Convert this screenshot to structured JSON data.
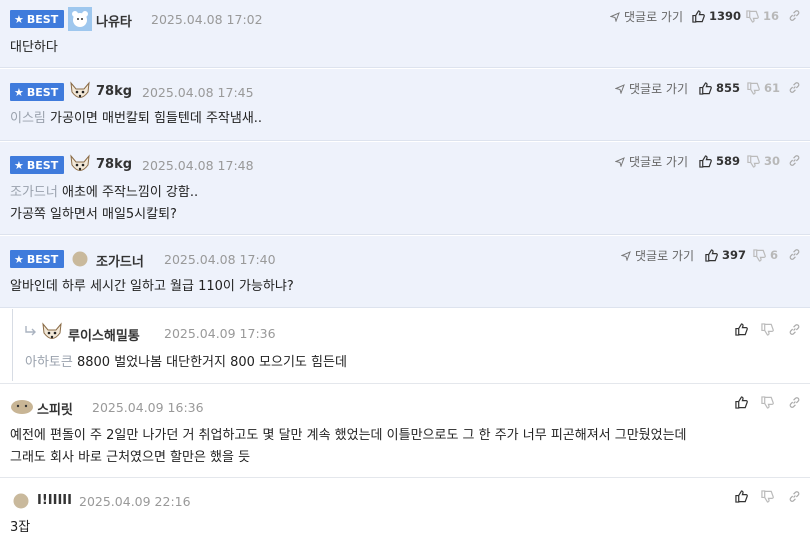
{
  "labels": {
    "best": "BEST",
    "reply_link": "댓글로 가기"
  },
  "comments": [
    {
      "nick": "나유타",
      "date": "2025.04.08 17:02",
      "up": "1390",
      "down": "16",
      "lines": [
        "대단하다"
      ]
    },
    {
      "nick": "78kg",
      "date": "2025.04.08 17:45",
      "up": "855",
      "down": "61",
      "quote": "이스림",
      "lines": [
        "가공이면 매번칼퇴 힘들텐데 주작냄새.."
      ]
    },
    {
      "nick": "78kg",
      "date": "2025.04.08 17:48",
      "up": "589",
      "down": "30",
      "quote": "조가드너",
      "lines": [
        "애초에 주작느낌이 강함..",
        "가공쪽 일하면서 매일5시칼퇴?"
      ]
    },
    {
      "nick": "조가드너",
      "date": "2025.04.08 17:40",
      "up": "397",
      "down": "6",
      "lines": [
        "알바인데 하루 세시간 일하고 월급 110이 가능하냐?"
      ]
    },
    {
      "nick": "루이스해밀통",
      "date": "2025.04.09 17:36",
      "quote": "아하토큰",
      "lines": [
        "8800 벌었나봄 대단한거지 800 모으기도 힘든데"
      ]
    },
    {
      "nick": "스피릿",
      "date": "2025.04.09 16:36",
      "lines": [
        "예전에 편돌이 주 2일만 나가던 거 취업하고도 몇 달만 계속 했었는데 이틀만으로도 그 한 주가 너무 피곤해져서 그만뒀었는데",
        "그래도 회사 바로 근처였으면 할만은 했을 듯"
      ]
    },
    {
      "nick": "I!IIIII",
      "date": "2025.04.09 22:16",
      "lines": [
        "3잡"
      ]
    }
  ],
  "colors": {
    "best_badge": "#3f7bdc",
    "best_bg": "#eef2fb"
  }
}
